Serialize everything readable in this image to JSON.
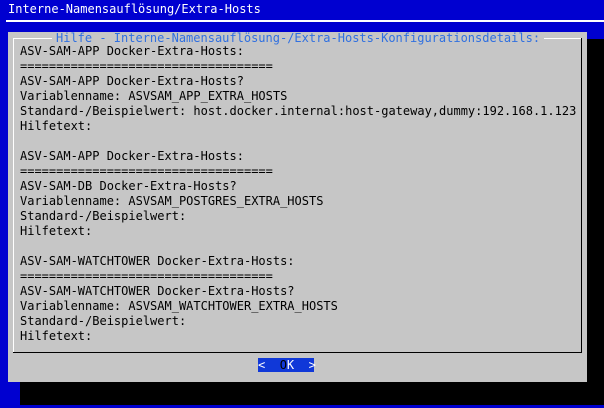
{
  "backtitle": "Interne-Namensauflösung/Extra-Hosts",
  "dialog": {
    "title": "Hilfe - Interne-Namensauflösung-/Extra-Hosts-Konfigurationsdetails:",
    "lines": [
      "ASV-SAM-APP Docker-Extra-Hosts:",
      "===================================",
      "ASV-SAM-APP Docker-Extra-Hosts?",
      "Variablenname: ASVSAM_APP_EXTRA_HOSTS",
      "Standard-/Beispielwert: host.docker.internal:host-gateway,dummy:192.168.1.123",
      "Hilfetext:",
      "",
      "ASV-SAM-APP Docker-Extra-Hosts:",
      "===================================",
      "ASV-SAM-DB Docker-Extra-Hosts?",
      "Variablenname: ASVSAM_POSTGRES_EXTRA_HOSTS",
      "Standard-/Beispielwert:",
      "Hilfetext:",
      "",
      "ASV-SAM-WATCHTOWER Docker-Extra-Hosts:",
      "===================================",
      "ASV-SAM-WATCHTOWER Docker-Extra-Hosts?",
      "Variablenname: ASVSAM_WATCHTOWER_EXTRA_HOSTS",
      "Standard-/Beispielwert:",
      "Hilfetext:"
    ],
    "ok_button": {
      "left": "<",
      "hot": "O",
      "rest": "K",
      "right": ">"
    }
  }
}
